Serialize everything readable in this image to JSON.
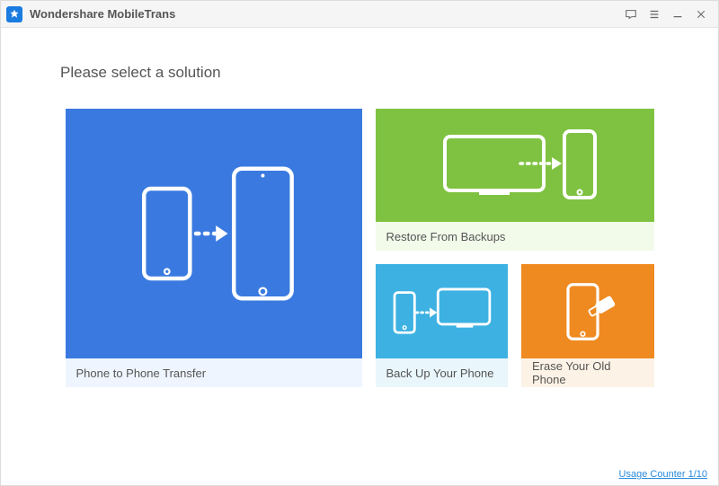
{
  "app": {
    "title": "Wondershare MobileTrans"
  },
  "heading": "Please select a solution",
  "tiles": {
    "p2p": {
      "label": "Phone to Phone Transfer"
    },
    "restore": {
      "label": "Restore From Backups"
    },
    "backup": {
      "label": "Back Up Your Phone"
    },
    "erase": {
      "label": "Erase Your Old Phone"
    }
  },
  "footer": {
    "usage": "Usage Counter 1/10"
  },
  "colors": {
    "blue": "#3a7ae0",
    "green": "#7fc241",
    "cyan": "#3cb1e2",
    "orange": "#ef8a20"
  }
}
